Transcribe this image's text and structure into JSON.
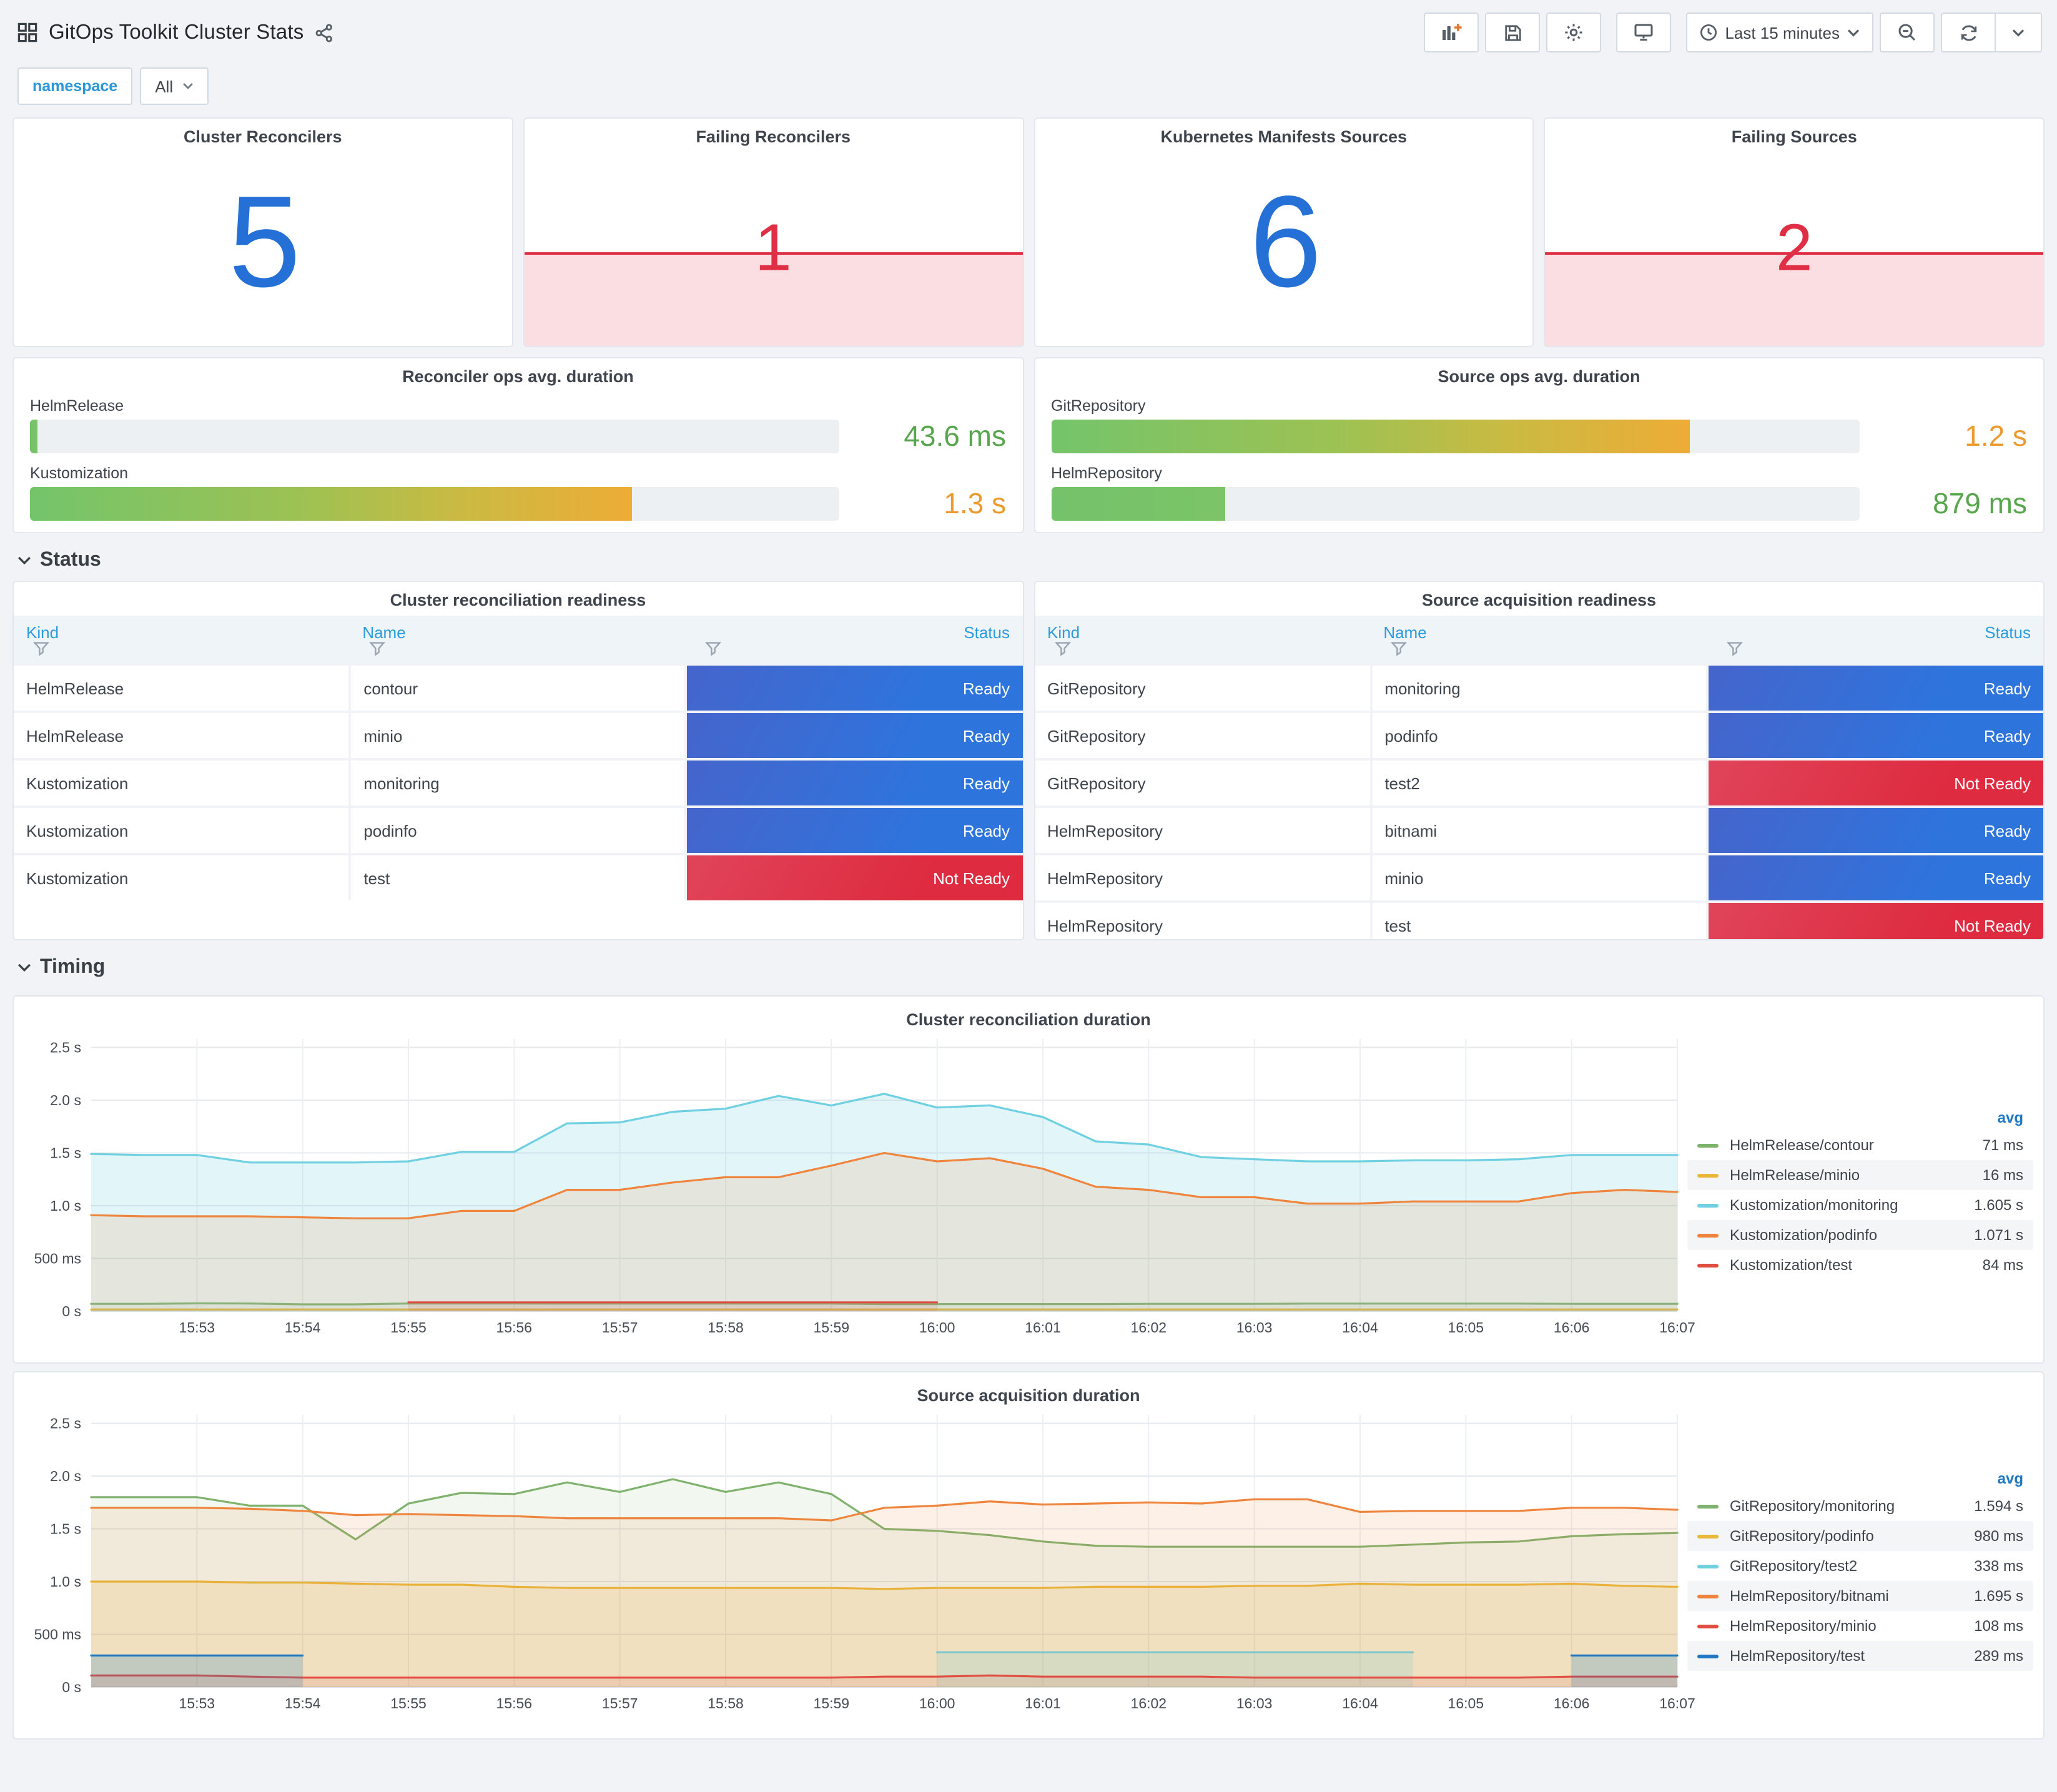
{
  "header": {
    "title": "GitOps Toolkit Cluster Stats"
  },
  "toolbar": {
    "time_range": "Last 15 minutes"
  },
  "icons": {
    "header": [
      "dashboards-icon",
      "share-icon"
    ],
    "toolbar": [
      "add-panel-icon",
      "save-icon",
      "settings-icon",
      "tv-icon",
      "clock-icon",
      "chevron-down-icon",
      "zoom-out-icon",
      "refresh-icon"
    ]
  },
  "variables": {
    "label": "namespace",
    "value": "All"
  },
  "sections": {
    "status": "Status",
    "timing": "Timing"
  },
  "colors": {
    "stat_blue": "#2470D6",
    "stat_red": "#E02F44",
    "ready": "#3274D9",
    "not_ready": "#E02F44"
  },
  "stats": [
    {
      "title": "Cluster Reconcilers",
      "value": "5",
      "color": "#2470D6",
      "failing": false
    },
    {
      "title": "Failing Reconcilers",
      "value": "1",
      "color": "#E02F44",
      "failing": true
    },
    {
      "title": "Kubernetes Manifests Sources",
      "value": "6",
      "color": "#2470D6",
      "failing": false
    },
    {
      "title": "Failing Sources",
      "value": "2",
      "color": "#E02F44",
      "failing": true
    }
  ],
  "gauges": [
    {
      "title": "Reconciler ops avg. duration",
      "rows": [
        {
          "label": "HelmRelease",
          "value": "43.6 ms",
          "value_color": "#56A64B",
          "percent": 1,
          "fill": "green"
        },
        {
          "label": "Kustomization",
          "value": "1.3 s",
          "value_color": "#EC9A2E",
          "percent": 74.5,
          "fill": "gradient"
        }
      ]
    },
    {
      "title": "Source ops avg. duration",
      "rows": [
        {
          "label": "GitRepository",
          "value": "1.2 s",
          "value_color": "#EC9A2E",
          "percent": 79,
          "fill": "gradient"
        },
        {
          "label": "HelmRepository",
          "value": "879 ms",
          "value_color": "#56A64B",
          "percent": 21.5,
          "fill": "green"
        }
      ]
    }
  ],
  "tables": [
    {
      "title": "Cluster reconciliation readiness",
      "columns": [
        "Kind",
        "Name",
        "Status"
      ],
      "rows": [
        {
          "kind": "HelmRelease",
          "name": "contour",
          "status": "Ready"
        },
        {
          "kind": "HelmRelease",
          "name": "minio",
          "status": "Ready"
        },
        {
          "kind": "Kustomization",
          "name": "monitoring",
          "status": "Ready"
        },
        {
          "kind": "Kustomization",
          "name": "podinfo",
          "status": "Ready"
        },
        {
          "kind": "Kustomization",
          "name": "test",
          "status": "Not Ready"
        }
      ]
    },
    {
      "title": "Source acquisition readiness",
      "columns": [
        "Kind",
        "Name",
        "Status"
      ],
      "rows": [
        {
          "kind": "GitRepository",
          "name": "monitoring",
          "status": "Ready"
        },
        {
          "kind": "GitRepository",
          "name": "podinfo",
          "status": "Ready"
        },
        {
          "kind": "GitRepository",
          "name": "test2",
          "status": "Not Ready"
        },
        {
          "kind": "HelmRepository",
          "name": "bitnami",
          "status": "Ready"
        },
        {
          "kind": "HelmRepository",
          "name": "minio",
          "status": "Ready"
        },
        {
          "kind": "HelmRepository",
          "name": "test",
          "status": "Not Ready"
        }
      ]
    }
  ],
  "chart_data": [
    {
      "type": "area",
      "title": "Cluster reconciliation duration",
      "x_start": "15:52",
      "x_end": "16:07",
      "step_seconds": 30,
      "x_ticks": [
        "15:53",
        "15:54",
        "15:55",
        "15:56",
        "15:57",
        "15:58",
        "15:59",
        "16:00",
        "16:01",
        "16:02",
        "16:03",
        "16:04",
        "16:05",
        "16:06",
        "16:07"
      ],
      "y_ticks": [
        {
          "v": 0,
          "label": "0 s"
        },
        {
          "v": 0.5,
          "label": "500 ms"
        },
        {
          "v": 1,
          "label": "1.0 s"
        },
        {
          "v": 1.5,
          "label": "1.5 s"
        },
        {
          "v": 2,
          "label": "2.0 s"
        },
        {
          "v": 2.5,
          "label": "2.5 s"
        }
      ],
      "y_max": 2.58,
      "ylabel": "",
      "grid": true,
      "legend_header": "avg",
      "legend_position": "right",
      "series": [
        {
          "name": "HelmRelease/contour",
          "avg": "71 ms",
          "color": "#7EB26D",
          "fill_opacity": 0.1,
          "values": [
            0.07,
            0.07,
            0.075,
            0.073,
            0.065,
            0.065,
            0.073,
            0.073,
            0.073,
            0.072,
            0.072,
            0.072,
            0.072,
            0.072,
            0.072,
            0.068,
            0.068,
            0.068,
            0.068,
            0.068,
            0.07,
            0.07,
            0.07,
            0.072,
            0.072,
            0.072,
            0.072,
            0.072,
            0.07,
            0.07,
            0.07
          ]
        },
        {
          "name": "HelmRelease/minio",
          "avg": "16 ms",
          "color": "#EAB839",
          "fill_opacity": 0.1,
          "values": [
            0.016,
            0.016,
            0.016,
            0.016,
            0.016,
            0.016,
            0.016,
            0.016,
            0.016,
            0.016,
            0.016,
            0.016,
            0.016,
            0.016,
            0.016,
            0.016,
            0.016,
            0.016,
            0.016,
            0.016,
            0.016,
            0.016,
            0.016,
            0.016,
            0.016,
            0.016,
            0.016,
            0.016,
            0.016,
            0.016,
            0.016
          ]
        },
        {
          "name": "Kustomization/monitoring",
          "avg": "1.605 s",
          "color": "#6ED0E0",
          "fill_opacity": 0.2,
          "values": [
            1.49,
            1.48,
            1.48,
            1.41,
            1.41,
            1.41,
            1.42,
            1.51,
            1.51,
            1.78,
            1.79,
            1.89,
            1.92,
            2.04,
            1.95,
            2.06,
            1.93,
            1.95,
            1.84,
            1.61,
            1.58,
            1.46,
            1.44,
            1.42,
            1.42,
            1.43,
            1.43,
            1.44,
            1.48,
            1.48,
            1.48
          ]
        },
        {
          "name": "Kustomization/podinfo",
          "avg": "1.071 s",
          "color": "#EF843C",
          "fill_opacity": 0.14,
          "values": [
            0.91,
            0.9,
            0.9,
            0.9,
            0.89,
            0.88,
            0.88,
            0.95,
            0.95,
            1.15,
            1.15,
            1.22,
            1.27,
            1.27,
            1.38,
            1.5,
            1.42,
            1.45,
            1.35,
            1.18,
            1.15,
            1.08,
            1.08,
            1.02,
            1.02,
            1.04,
            1.04,
            1.04,
            1.12,
            1.15,
            1.13
          ]
        },
        {
          "name": "Kustomization/test",
          "avg": "84 ms",
          "color": "#E24D42",
          "fill_opacity": 0.12,
          "values": [
            null,
            null,
            null,
            null,
            null,
            null,
            0.084,
            0.084,
            0.084,
            0.084,
            0.084,
            0.084,
            0.084,
            0.084,
            0.084,
            0.084,
            0.084,
            null,
            null,
            null,
            null,
            null,
            null,
            null,
            null,
            null,
            null,
            null,
            null,
            null,
            null
          ]
        }
      ]
    },
    {
      "type": "area",
      "title": "Source acquisition duration",
      "x_start": "15:52",
      "x_end": "16:07",
      "step_seconds": 30,
      "x_ticks": [
        "15:53",
        "15:54",
        "15:55",
        "15:56",
        "15:57",
        "15:58",
        "15:59",
        "16:00",
        "16:01",
        "16:02",
        "16:03",
        "16:04",
        "16:05",
        "16:06",
        "16:07"
      ],
      "y_ticks": [
        {
          "v": 0,
          "label": "0 s"
        },
        {
          "v": 0.5,
          "label": "500 ms"
        },
        {
          "v": 1,
          "label": "1.0 s"
        },
        {
          "v": 1.5,
          "label": "1.5 s"
        },
        {
          "v": 2,
          "label": "2.0 s"
        },
        {
          "v": 2.5,
          "label": "2.5 s"
        }
      ],
      "y_max": 2.58,
      "ylabel": "",
      "grid": true,
      "legend_header": "avg",
      "legend_position": "right",
      "series": [
        {
          "name": "GitRepository/monitoring",
          "avg": "1.594 s",
          "color": "#7EB26D",
          "fill_opacity": 0.1,
          "values": [
            1.8,
            1.8,
            1.8,
            1.72,
            1.72,
            1.4,
            1.74,
            1.84,
            1.83,
            1.94,
            1.85,
            1.97,
            1.85,
            1.94,
            1.83,
            1.5,
            1.48,
            1.44,
            1.38,
            1.34,
            1.33,
            1.33,
            1.33,
            1.33,
            1.33,
            1.35,
            1.37,
            1.38,
            1.43,
            1.45,
            1.46
          ]
        },
        {
          "name": "GitRepository/podinfo",
          "avg": "980 ms",
          "color": "#EAB839",
          "fill_opacity": 0.16,
          "values": [
            1.0,
            1.0,
            1.0,
            0.99,
            0.99,
            0.98,
            0.97,
            0.97,
            0.95,
            0.94,
            0.94,
            0.94,
            0.94,
            0.94,
            0.94,
            0.93,
            0.94,
            0.94,
            0.94,
            0.95,
            0.95,
            0.95,
            0.96,
            0.96,
            0.98,
            0.97,
            0.97,
            0.97,
            0.98,
            0.96,
            0.95
          ]
        },
        {
          "name": "GitRepository/test2",
          "avg": "338 ms",
          "color": "#6ED0E0",
          "fill_opacity": 0.22,
          "values": [
            null,
            null,
            null,
            null,
            null,
            null,
            null,
            null,
            null,
            null,
            null,
            null,
            null,
            null,
            null,
            null,
            0.33,
            0.33,
            0.33,
            0.33,
            0.33,
            0.33,
            0.33,
            0.33,
            0.33,
            0.33,
            null,
            null,
            null,
            null,
            null
          ]
        },
        {
          "name": "HelmRepository/bitnami",
          "avg": "1.695 s",
          "color": "#EF843C",
          "fill_opacity": 0.12,
          "values": [
            1.7,
            1.7,
            1.7,
            1.69,
            1.67,
            1.63,
            1.64,
            1.63,
            1.62,
            1.6,
            1.6,
            1.6,
            1.6,
            1.6,
            1.58,
            1.7,
            1.72,
            1.76,
            1.73,
            1.74,
            1.75,
            1.74,
            1.78,
            1.78,
            1.66,
            1.67,
            1.67,
            1.67,
            1.7,
            1.7,
            1.68
          ]
        },
        {
          "name": "HelmRepository/minio",
          "avg": "108 ms",
          "color": "#E24D42",
          "fill_opacity": 0.12,
          "values": [
            0.11,
            0.11,
            0.11,
            0.1,
            0.09,
            0.09,
            0.09,
            0.09,
            0.09,
            0.09,
            0.09,
            0.09,
            0.09,
            0.09,
            0.09,
            0.1,
            0.1,
            0.11,
            0.1,
            0.1,
            0.1,
            0.1,
            0.09,
            0.09,
            0.09,
            0.09,
            0.09,
            0.09,
            0.1,
            0.1,
            0.1
          ]
        },
        {
          "name": "HelmRepository/test",
          "avg": "289 ms",
          "color": "#1F78C1",
          "fill_opacity": 0.22,
          "values": [
            0.3,
            0.3,
            0.3,
            0.3,
            0.3,
            null,
            null,
            null,
            null,
            null,
            null,
            null,
            null,
            null,
            null,
            null,
            null,
            null,
            null,
            null,
            null,
            null,
            null,
            null,
            null,
            null,
            null,
            null,
            0.3,
            0.3,
            0.3
          ]
        }
      ]
    }
  ]
}
